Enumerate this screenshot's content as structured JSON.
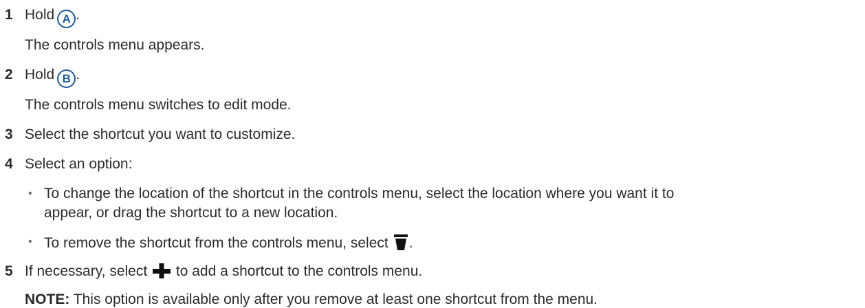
{
  "steps": [
    {
      "number": "1",
      "text_before": "Hold",
      "key": "A",
      "text_after": ".",
      "result": "The controls menu appears."
    },
    {
      "number": "2",
      "text_before": "Hold",
      "key": "B",
      "text_after": ".",
      "result": "The controls menu switches to edit mode."
    },
    {
      "number": "3",
      "text": "Select the shortcut you want to customize."
    },
    {
      "number": "4",
      "text": "Select an option:",
      "options": [
        {
          "line1": "To change the location of the shortcut in the controls menu, select the location where you want it to",
          "line2": "appear, or drag the shortcut to a new location."
        },
        {
          "text_before": "To remove the shortcut from the controls menu, select",
          "icon": "trash-icon",
          "text_after": "."
        }
      ]
    },
    {
      "number": "5",
      "text_before": "If necessary, select",
      "icon": "plus-icon",
      "text_after": "to add a shortcut to the controls menu.",
      "note_label": "NOTE:",
      "note_text": "This option is available only after you remove at least one shortcut from the menu."
    }
  ],
  "colors": {
    "text": "#2b2b2b",
    "key_blue": "#1f5c99",
    "icon": "#111111"
  }
}
